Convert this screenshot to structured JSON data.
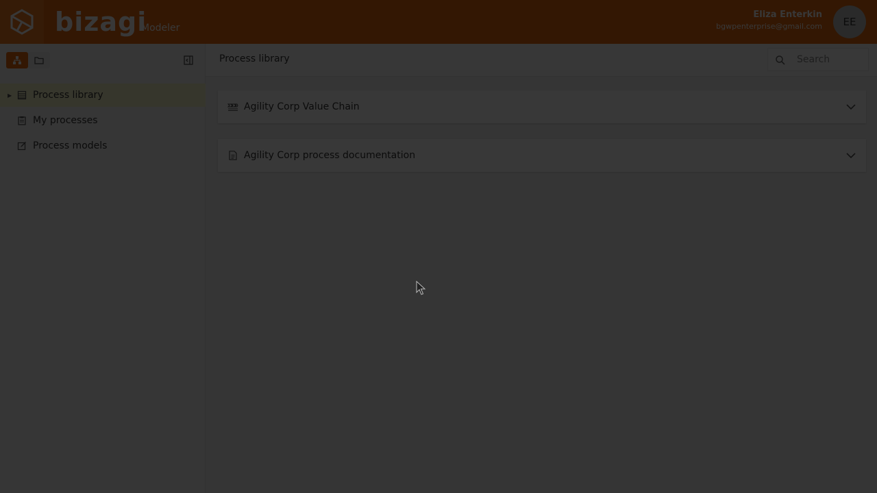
{
  "header": {
    "brand": "bizagi",
    "product": "Modeler",
    "user": {
      "name": "Eliza Enterkin",
      "email": "bgwpenterprise@gmail.com",
      "initials": "EE"
    }
  },
  "sidebar": {
    "items": [
      {
        "label": "Process library",
        "icon": "list-icon",
        "selected": true
      },
      {
        "label": "My processes",
        "icon": "clipboard-icon",
        "selected": false
      },
      {
        "label": "Process models",
        "icon": "edit-model-icon",
        "selected": false
      }
    ]
  },
  "main": {
    "title": "Process library",
    "search": {
      "placeholder": "Search",
      "value": ""
    },
    "cards": [
      {
        "label": "Agility Corp Value Chain",
        "icon": "value-chain-icon"
      },
      {
        "label": "Agility Corp process documentation",
        "icon": "document-icon"
      }
    ]
  },
  "colors": {
    "brand_orange": "#e66a10",
    "logo_orange": "#f07d22",
    "selected_row": "#f4f3c9"
  }
}
